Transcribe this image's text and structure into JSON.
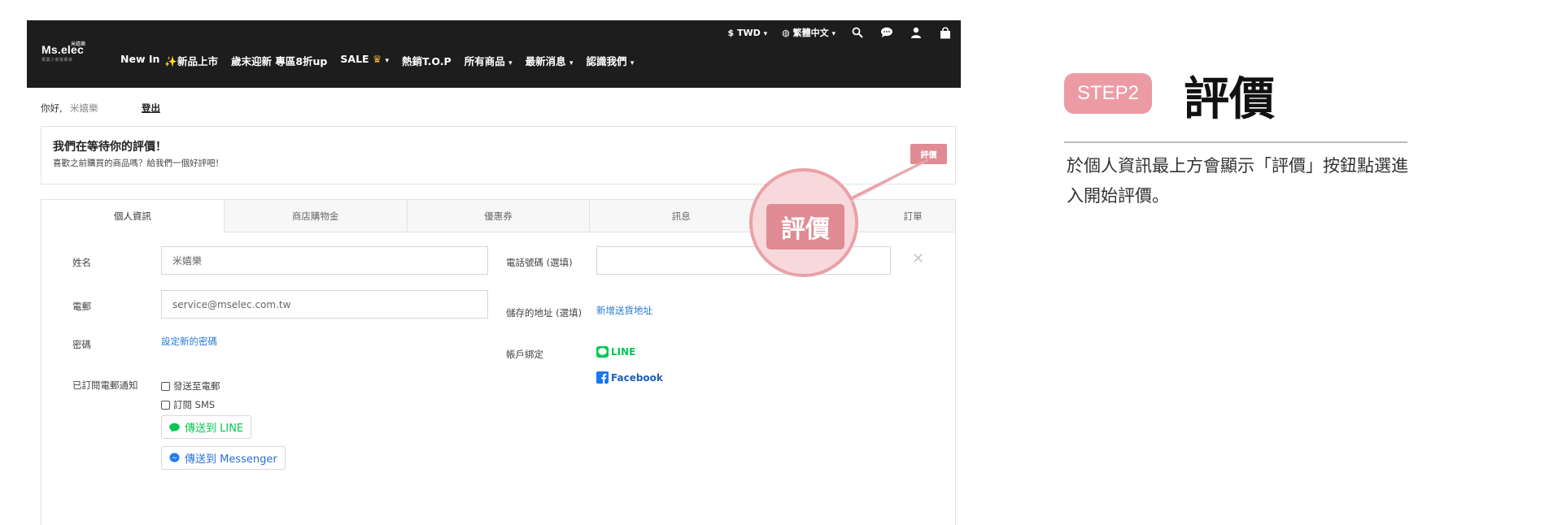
{
  "header": {
    "logo": "Ms.elec",
    "logo_badge": "米嬉樂",
    "logo_sub": "專業小家電專家",
    "currency": "$ TWD",
    "language": "繁體中文",
    "nav": [
      {
        "label": "New In",
        "has_dropdown": false
      },
      {
        "label": "新品上市",
        "has_dropdown": false
      },
      {
        "label": "歲末迎新 專區8折up",
        "has_dropdown": false
      },
      {
        "label": "SALE",
        "has_dropdown": true
      },
      {
        "label": "熱銷T.O.P",
        "has_dropdown": false
      },
      {
        "label": "所有商品",
        "has_dropdown": true
      },
      {
        "label": "最新消息",
        "has_dropdown": true
      },
      {
        "label": "認識我們",
        "has_dropdown": true
      }
    ],
    "icons": [
      "search-icon",
      "chat-icon",
      "user-icon",
      "bag-icon"
    ]
  },
  "greeting": {
    "hello": "你好,",
    "name": "米嬉樂",
    "logout": "登出"
  },
  "review_banner": {
    "title": "我們在等待你的評價！",
    "subtitle": "喜歡之前購買的商品嗎？給我們一個好評吧！",
    "button": "評價"
  },
  "tabs": [
    {
      "label": "個人資訊",
      "active": true
    },
    {
      "label": "商店購物金",
      "active": false
    },
    {
      "label": "優惠券",
      "active": false
    },
    {
      "label": "訊息",
      "active": false
    },
    {
      "label": "訂單",
      "active": false
    }
  ],
  "form": {
    "name_label": "姓名",
    "name_value": "米嬉樂",
    "email_label": "電郵",
    "email_value": "service@mselec.com.tw",
    "password_label": "密碼",
    "password_link": "設定新的密碼",
    "subscribe_label": "已訂閱電郵通知",
    "subscribe_email": "發送至電郵",
    "subscribe_sms": "訂閱 SMS",
    "send_line": "傳送到 LINE",
    "send_messenger": "傳送到 Messenger",
    "phone_label": "電話號碼 (選填)",
    "phone_value": "",
    "address_label": "儲存的地址 (選填)",
    "address_link": "新增送貨地址",
    "account_label": "帳戶綁定",
    "line_label": "LINE",
    "facebook_label": "Facebook"
  },
  "callout": {
    "label": "評價"
  },
  "instructions": {
    "step": "STEP2",
    "title": "評價",
    "description": "於個人資訊最上方會顯示「評價」按鈕點選進入開始評價。"
  },
  "colors": {
    "accent_pink": "#e08b93",
    "header_bg": "#1d1d1d",
    "link_blue": "#2a7ad1",
    "line_green": "#06c755",
    "facebook_blue": "#1877f2"
  }
}
